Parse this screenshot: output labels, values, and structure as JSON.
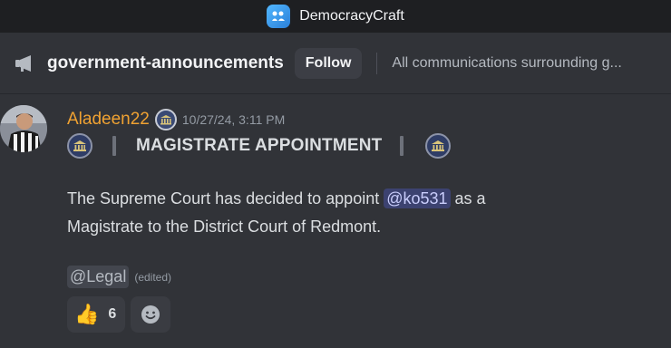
{
  "app": {
    "server_name": "DemocracyCraft"
  },
  "channel": {
    "name": "government-announcements",
    "follow_label": "Follow",
    "topic": "All communications surrounding g..."
  },
  "message": {
    "author": "Aladeen22",
    "timestamp": "10/27/24, 3:11 PM",
    "announcement_title": "MAGISTRATE APPOINTMENT",
    "body_before": "The Supreme Court has decided to appoint ",
    "user_mention": "@ko531",
    "body_after_1": " as a",
    "body_line2": "Magistrate to the District Court of Redmont.",
    "role_mention": "@Legal",
    "edited_label": "(edited)",
    "reactions": [
      {
        "emoji": "👍",
        "count": "6"
      }
    ]
  },
  "colors": {
    "username": "#f0a232",
    "mention_bg": "#3c4270",
    "background": "#313338"
  },
  "icons": {
    "channel": "megaphone-icon",
    "role_badge": "capitol-badge-icon",
    "add_reaction": "smiley-add-reaction-icon"
  }
}
